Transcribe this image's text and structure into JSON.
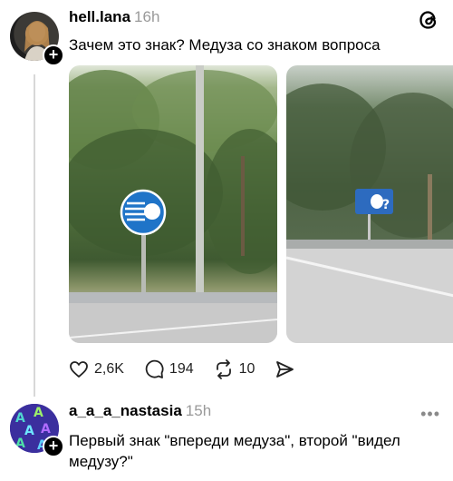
{
  "post": {
    "username": "hell.lana",
    "time": "16h",
    "text": "Зачем это знак? Медуза со знаком вопроса",
    "add_label": "+",
    "actions": {
      "likes": "2,6K",
      "comments": "194",
      "reposts": "10"
    }
  },
  "reply": {
    "username": "a_a_a_nastasia",
    "time": "15h",
    "text": "Первый знак \"впереди медуза\", второй \"видел медузу?\"",
    "more_label": "•••",
    "add_label": "+",
    "avatar_glyph": "A"
  },
  "colors": {
    "sign_blue": "#1f74c8",
    "secondary_text": "#9a9a9a"
  }
}
